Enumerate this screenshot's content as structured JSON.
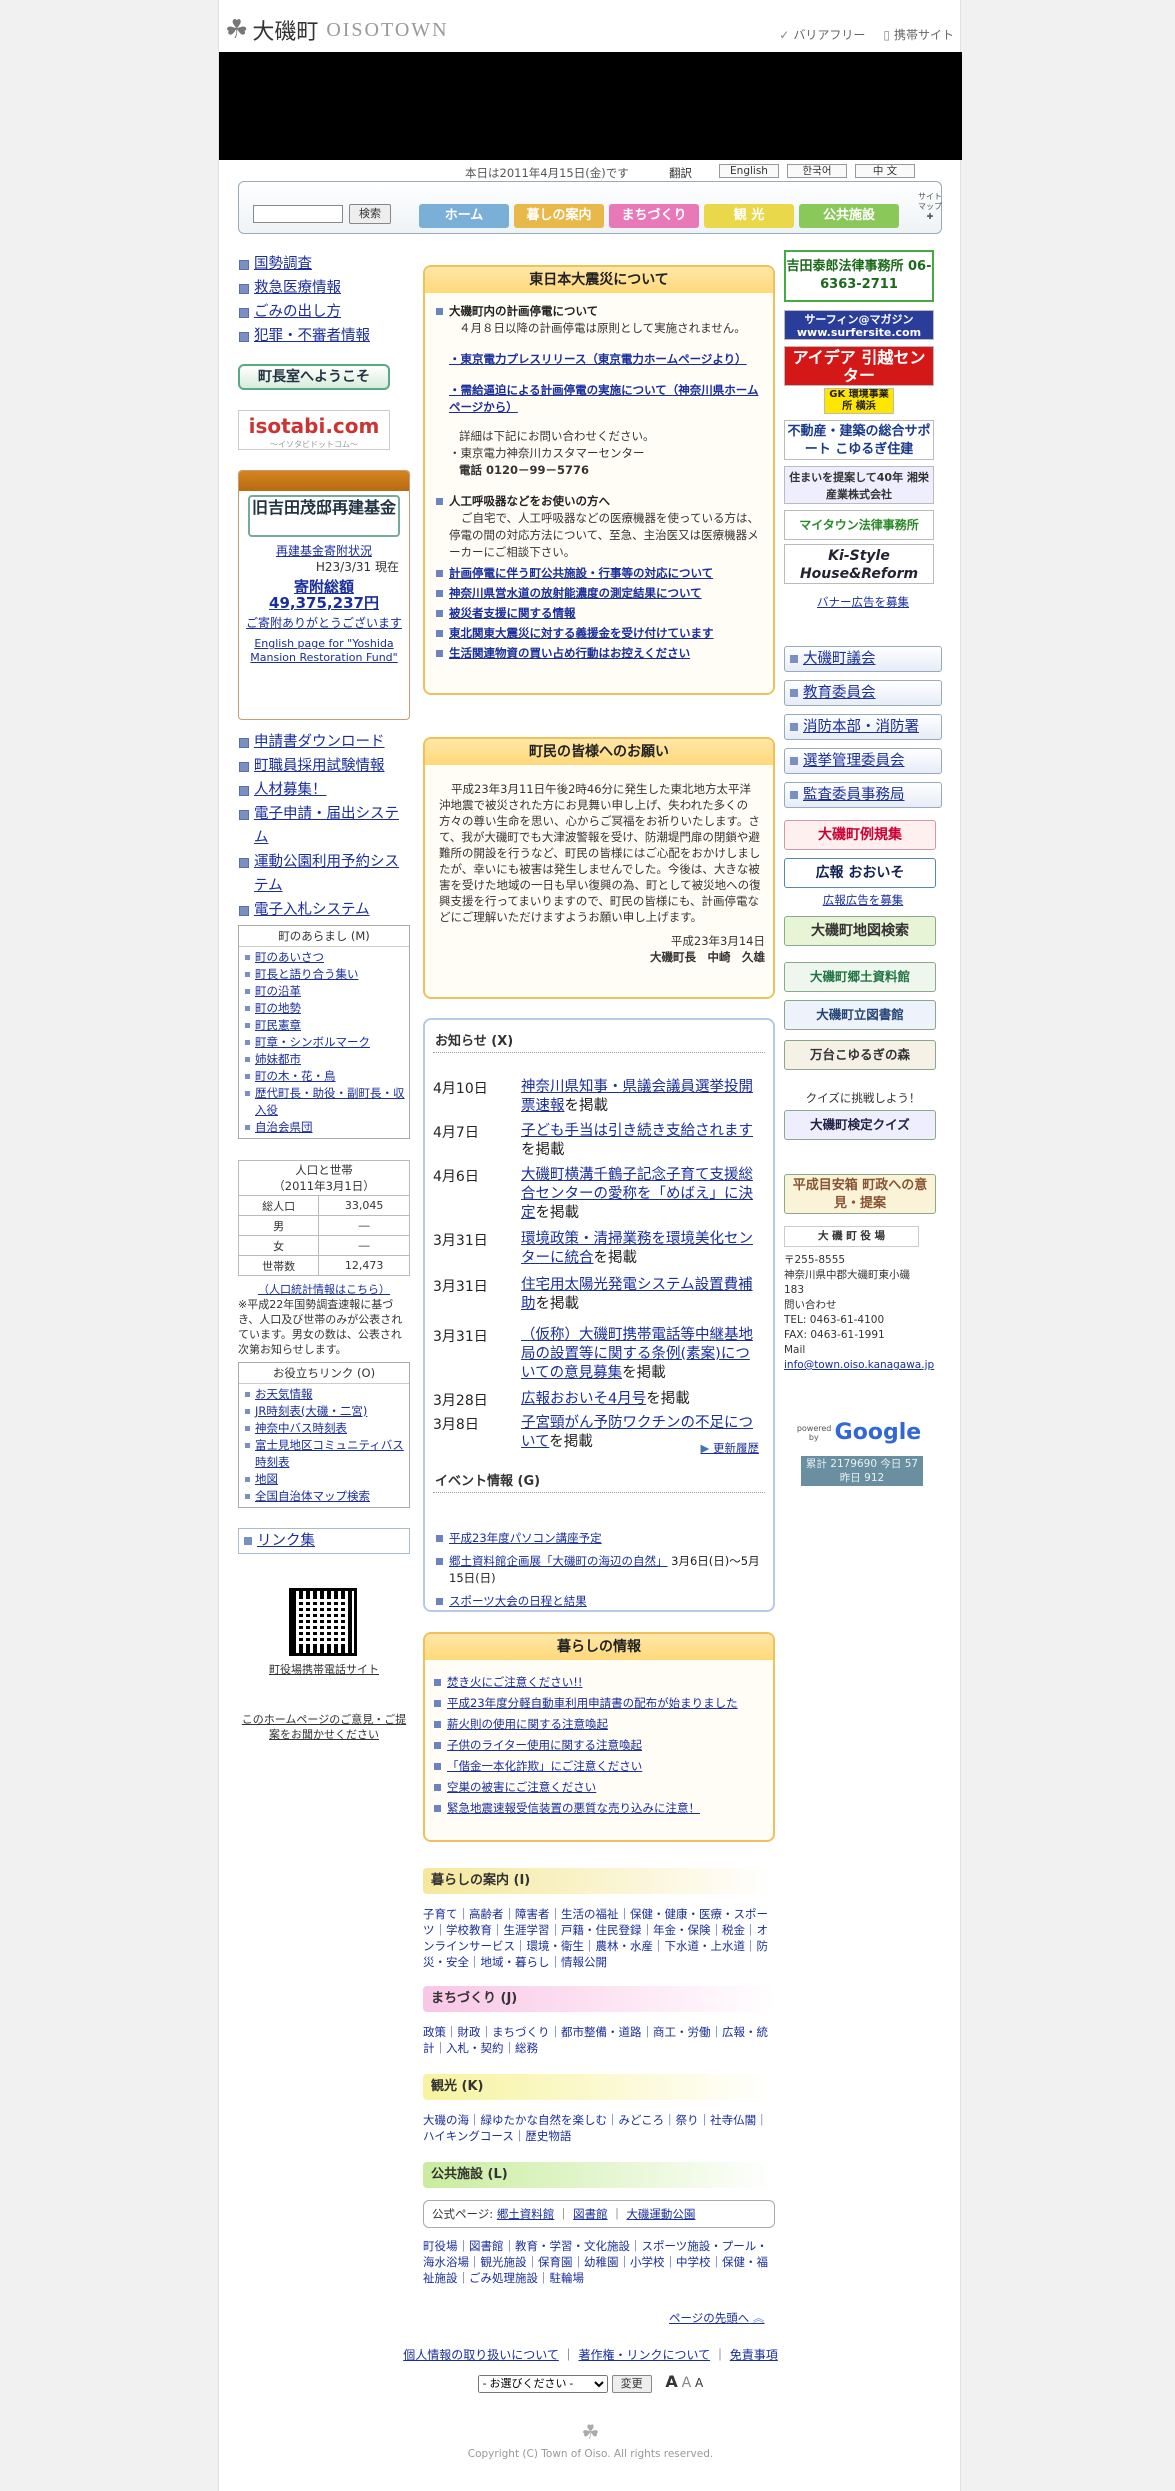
{
  "header": {
    "logo_ja": "大磯町",
    "logo_en": "OISOTOWN",
    "barrier_free": "バリアフリー",
    "mobile_site": "携帯サイト",
    "date_text": "本日は2011年4月15日(金)です",
    "translate_label": "翻訳",
    "lang_en": "English",
    "lang_ko": "한국어",
    "lang_zh": "中 文"
  },
  "search": {
    "placeholder": "",
    "button": "検索"
  },
  "nav": {
    "tabs": [
      {
        "label": "ホーム",
        "color": "#7ab0d8"
      },
      {
        "label": "暮しの案内",
        "color": "#e8b84a"
      },
      {
        "label": "まちづくり",
        "color": "#e879b8"
      },
      {
        "label": "観 光",
        "color": "#e8d84a"
      },
      {
        "label": "公共施設",
        "color": "#8ac85a"
      }
    ],
    "sitemap": "サイトマップ"
  },
  "left": {
    "top_links": [
      "国勢調査",
      "救急医療情報",
      "ごみの出し方",
      "犯罪・不審者情報"
    ],
    "mayor_button": "町長室へようこそ",
    "isotabi": "isotabi.com",
    "isotabi_sub": "～イソタビドットコム～",
    "fund": {
      "logo": "旧吉田茂邸再建基金",
      "status_link": "再建基金寄附状況",
      "as_of": "H23/3/31 現在",
      "total_label": "寄附総額",
      "total_amount": "49,375,237円",
      "thanks": "ご寄附ありがとうございます",
      "english": "English page for \"Yoshida Mansion Restoration Fund\""
    },
    "services": [
      "申請書ダウンロード",
      "町職員採用試験情報",
      "人材募集！",
      "電子申請・届出システム",
      "運動公園利用予約システム",
      "電子入札システム"
    ],
    "outline": {
      "title": "町のあらまし (M)",
      "items": [
        "町のあいさつ",
        "町長と語り合う集い",
        "町の沿革",
        "町の地勢",
        "町民憲章",
        "町章・シンボルマーク",
        "姉妹都市",
        "町の木・花・鳥",
        "歴代町長・助役・副町長・収入役",
        "自治会県団"
      ]
    },
    "population": {
      "title": "人口と世帯",
      "date": "（2011年3月1日）",
      "rows": [
        {
          "label": "総人口",
          "value": "33,045"
        },
        {
          "label": "男",
          "value": "―"
        },
        {
          "label": "女",
          "value": "―"
        },
        {
          "label": "世帯数",
          "value": "12,473"
        }
      ],
      "stats_link": "（人口統計情報はこちら）",
      "note": "※平成22年国勢調査速報に基づき、人口及び世帯のみが公表されています。男女の数は、公表され次第お知らせします。"
    },
    "useful": {
      "title": "お役立ちリンク (O)",
      "items": [
        "お天気情報",
        "JR時刻表(大磯・二宮)",
        "神奈中バス時刻表",
        "富士見地区コミュニティバス時刻表",
        "地図",
        "全国自治体マップ検索"
      ]
    },
    "link_collection": "リンク集",
    "mobile_site_link": "町役場携帯電話サイト",
    "opinion_link": "このホームページのご意見・ご提案をお聞かせください"
  },
  "disaster": {
    "title": "東日本大震災について",
    "planned_outage_title": "大磯町内の計画停電について",
    "planned_outage_text": "４月８日以降の計画停電は原則として実施されません。",
    "tepco_link": "・東京電力プレスリリース（東京電力ホームページより）",
    "kanagawa_link": "・需給逼迫による計画停電の実施について（神奈川県ホームページから）",
    "contact_text": "詳細は下記にお問い合わせください。",
    "contact_center": "・東京電力神奈川カスタマーセンター",
    "phone": "電話 0120－99－5776",
    "medical_title": "人工呼吸器などをお使いの方へ",
    "medical_text": "ご自宅で、人工呼吸器などの医療機器を使っている方は、停電の間の対応方法について、至急、主治医又は医療機器メーカーにご相談下さい。",
    "links": [
      "計画停電に伴う町公共施設・行事等の対応について",
      "神奈川県営水道の放射能濃度の測定結果について",
      "被災者支援に関する情報",
      "東北関東大震災に対する義援金を受け付けています",
      "生活関連物資の買い占め行動はお控えください"
    ]
  },
  "appeal": {
    "title": "町民の皆様へのお願い",
    "text": "平成23年3月11日午後2時46分に発生した東北地方太平洋沖地震で被災された方にお見舞い申し上げ、失われた多くの方々の尊い生命を思い、心からご冥福をお祈りいたします。さて、我が大磯町でも大津波警報を受け、防潮堤門扉の閉鎖や避難所の開設を行うなど、町民の皆様にはご心配をおかけしましたが、幸いにも被害は発生しませんでした。今後は、大きな被害を受けた地域の一日も早い復興の為、町として被災地への復興支援を行ってまいりますので、町民の皆様にも、計画停電などにご理解いただけますようお願い申し上げます。",
    "date": "平成23年3月14日",
    "signature": "大磯町長　中崎　久雄"
  },
  "news": {
    "title": "お知らせ (X)",
    "items": [
      {
        "date": "4月10日",
        "text": "神奈川県知事・県議会議員選挙投開票速報",
        "suffix": "を掲載"
      },
      {
        "date": "4月7日",
        "text": "子ども手当は引き続き支給されます",
        "suffix": "を掲載"
      },
      {
        "date": "4月6日",
        "text": "大磯町横溝千鶴子記念子育て支援総合センターの愛称を「めばえ」に決定",
        "suffix": "を掲載"
      },
      {
        "date": "3月31日",
        "text": "環境政策・清掃業務を環境美化センターに統合",
        "suffix": "を掲載"
      },
      {
        "date": "3月31日",
        "text": "住宅用太陽光発電システム設置費補助",
        "suffix": "を掲載"
      },
      {
        "date": "3月31日",
        "text": "（仮称）大磯町携帯電話等中継基地局の設置等に関する条例(素案)についての意見募集",
        "suffix": "を掲載"
      },
      {
        "date": "3月28日",
        "text": "広報おおいそ4月号",
        "suffix": "を掲載"
      },
      {
        "date": "3月8日",
        "text": "子宮頸がん予防ワクチンの不足について",
        "suffix": "を掲載"
      }
    ],
    "history": "更新履歴",
    "events_title": "イベント情報 (G)",
    "events": [
      {
        "text": "平成23年度パソコン講座予定",
        "suffix": ""
      },
      {
        "text": "郷土資料館企画展「大磯町の海辺の自然」",
        "suffix": "3月6日(日)～5月15日(日)"
      },
      {
        "text": "スポーツ大会の日程と結果",
        "suffix": ""
      }
    ]
  },
  "living": {
    "title": "暮らしの情報",
    "items": [
      "焚き火にご注意ください!!",
      "平成23年度分軽自動車利用申請書の配布が始まりました",
      "薪火則の使用に関する注意喚起",
      "子供のライター使用に関する注意喚起",
      "「偕金一本化詐欺」にご注意ください",
      "空巣の被害にご注意ください",
      "緊急地震速報受信装置の悪質な売り込みに注意！"
    ]
  },
  "categories": [
    {
      "title": "暮らしの案内 (I)",
      "color": "#f5e89c",
      "text": "子育て｜高齢者｜障害者｜生活の福祉｜保健・健康・医療・スポーツ｜学校教育｜生涯学習｜戸籍・住民登録｜年金・保険｜税金｜オンラインサービス｜環境・衛生｜農林・水産｜下水道・上水道｜防災・安全｜地域・暮らし｜情報公開"
    },
    {
      "title": "まちづくり (J)",
      "color": "#f9c6e6",
      "text": "政策｜財政｜まちづくり｜都市整備・道路｜商工・労働｜広報・統計｜入札・契約｜総務"
    },
    {
      "title": "観光 (K)",
      "color": "#f7f3a0",
      "text": "大磯の海｜緑ゆたかな自然を楽しむ｜みどころ｜祭り｜社寺仏閣｜ハイキングコース｜歴史物語"
    },
    {
      "title": "公共施設 (L)",
      "color": "#c9ec9e",
      "text": "町役場｜図書館｜教育・学習・文化施設｜スポーツ施設・プール・海水浴場｜観光施設｜保育園｜幼稚園｜小学校｜中学校｜保健・福祉施設｜ごみ処理施設｜駐輪場"
    }
  ],
  "official": {
    "label": "公式ページ:",
    "links": [
      "郷土資料館",
      "図書館",
      "大磯運動公園"
    ]
  },
  "right": {
    "ads": [
      "吉田泰郎法律事務所 06-6363-2711",
      "サーフィン@マガジン www.surfersite.com",
      "アイデア 引越センター",
      "GK 環境事業所 横浜",
      "不動産・建築の総合サポート こゆるぎ住建",
      "住まいを提案して40年 湘栄産業株式会社",
      "マイタウン法律事務所",
      "Ki-Style House&Reform"
    ],
    "banner_link": "バナー広告を募集",
    "buttons": [
      "大磯町議会",
      "教育委員会",
      "消防本部・消防署",
      "選挙管理委員会",
      "監査委員事務局"
    ],
    "reiki": "大磯町例規集",
    "kouhou": "広報 おおいそ",
    "kouhou_link": "広報広告を募集",
    "map": "大磯町地図検索",
    "museum": "大磯町郷土資料館",
    "library": "大磯町立図書館",
    "kodomo": "万台こゆるぎの森",
    "quiz_label": "クイズに挑戦しよう！",
    "quiz": "大磯町検定クイズ",
    "opinion": "平成目安箱 町政への意見・提案",
    "office": {
      "title": "大 磯 町 役 場",
      "zip": "〒255-8555",
      "address": "神奈川県中郡大磯町東小磯183",
      "contact": "問い合わせ",
      "tel": "TEL: 0463-61-4100",
      "fax": "FAX: 0463-61-1991",
      "mail_label": "Mail",
      "mail": "info@town.oiso.kanagawa.jp"
    },
    "google_powered": "powered by",
    "google": "Google",
    "counter": "累計 2179690 今日 57 昨日 912"
  },
  "footer": {
    "top_link": "ページの先頭へ",
    "links": [
      "個人情報の取り扱いについて",
      "著作権・リンクについて",
      "免責事項"
    ],
    "select": "- お選びください -",
    "change": "変更",
    "copyright": "Copyright (C) Town of Oiso. All rights reserved."
  }
}
